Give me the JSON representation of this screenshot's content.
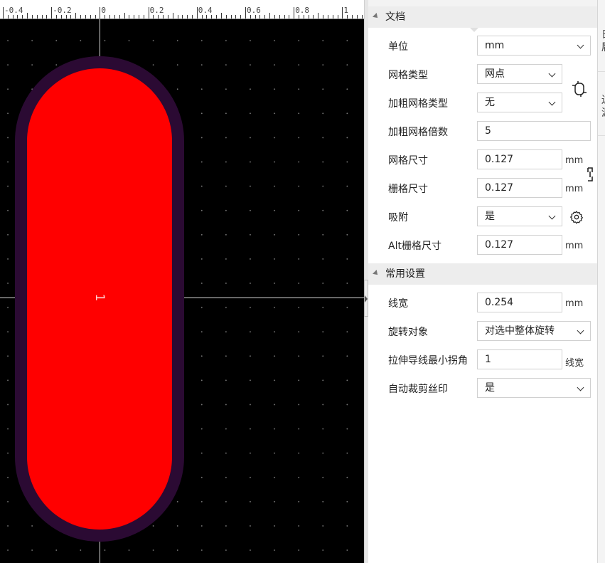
{
  "canvas": {
    "ruler_labels": [
      "-0.4",
      "-0.2",
      "0",
      "0.2",
      "0.4",
      "0.6",
      "0.8",
      "1"
    ],
    "pad_number": "1",
    "colors": {
      "background": "#000000",
      "pad": "#ff0000",
      "pad_outline": "#2b0a33"
    }
  },
  "panel": {
    "sections": {
      "document": "文档",
      "common": "常用设置"
    },
    "document": {
      "unit": {
        "label": "单位",
        "value": "mm"
      },
      "grid_type": {
        "label": "网格类型",
        "value": "网点"
      },
      "bold_grid_type": {
        "label": "加粗网格类型",
        "value": "无"
      },
      "bold_grid_multiple": {
        "label": "加粗网格倍数",
        "value": "5"
      },
      "grid_size": {
        "label": "网格尺寸",
        "value": "0.127",
        "unit": "mm"
      },
      "snap_size": {
        "label": "栅格尺寸",
        "value": "0.127",
        "unit": "mm"
      },
      "snap": {
        "label": "吸附",
        "value": "是"
      },
      "alt_snap_size": {
        "label": "Alt栅格尺寸",
        "value": "0.127",
        "unit": "mm"
      }
    },
    "common": {
      "line_width": {
        "label": "线宽",
        "value": "0.254",
        "unit": "mm"
      },
      "rotate_object": {
        "label": "旋转对象",
        "value": "对选中整体旋转"
      },
      "min_corner": {
        "label": "拉伸导线最小拐角",
        "value": "1",
        "unit": "线宽"
      },
      "auto_clip_silk": {
        "label": "自动裁剪丝印",
        "value": "是"
      }
    },
    "icons": {
      "grid_settings": "grid-settings-icon",
      "snap_settings": "gear-icon",
      "link": "link-icon"
    }
  },
  "right_strip": {
    "chars": [
      "日",
      "履",
      "边",
      "源"
    ]
  }
}
